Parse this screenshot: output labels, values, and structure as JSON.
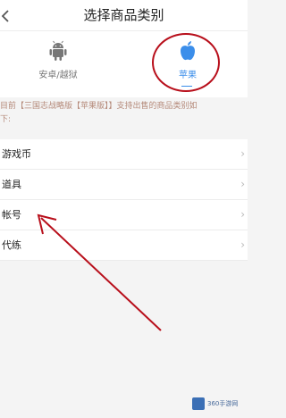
{
  "header": {
    "title": "选择商品类别"
  },
  "tabs": [
    {
      "label": "安卓/越狱",
      "icon": "android-icon"
    },
    {
      "label": "苹果",
      "icon": "apple-icon"
    }
  ],
  "notice": {
    "line1": "目前【三国志战略版【苹果版】】支持出售的商品类别如",
    "line2": "下:"
  },
  "list": [
    {
      "label": "游戏币"
    },
    {
      "label": "道具"
    },
    {
      "label": "帐号"
    },
    {
      "label": "代练"
    }
  ],
  "watermark": {
    "text": "360手游网"
  },
  "colors": {
    "accent": "#3b8eea",
    "annotation_red": "#b80f1b",
    "notice_text": "#b58a7a"
  }
}
